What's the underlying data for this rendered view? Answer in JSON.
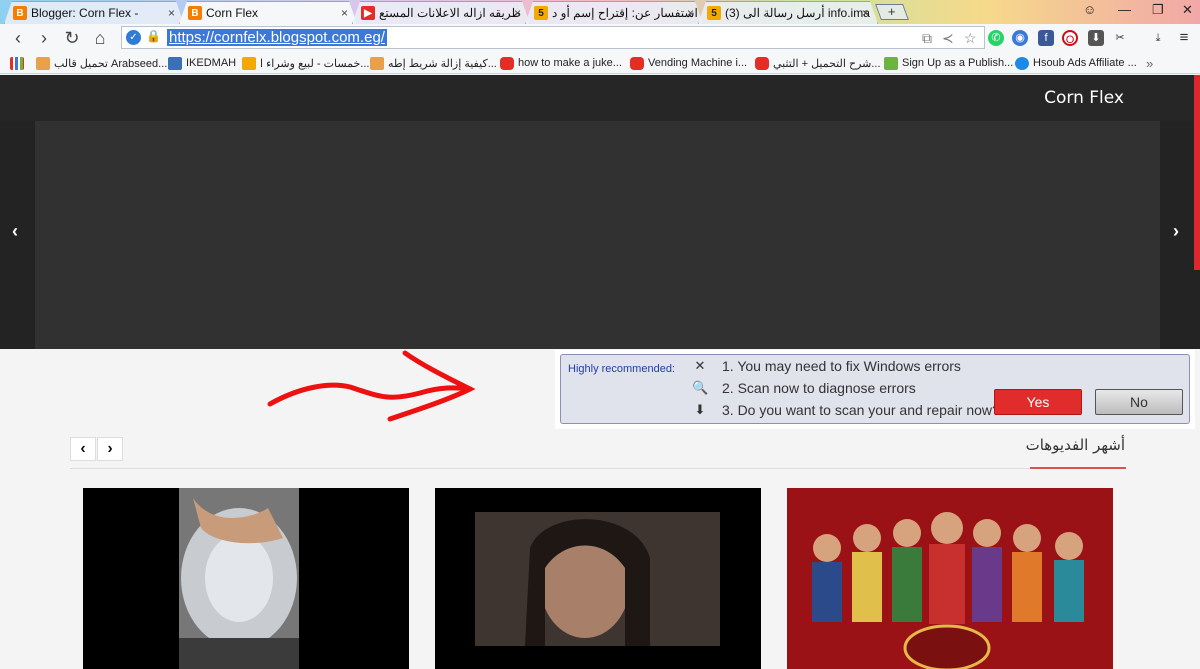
{
  "tabs": [
    {
      "title": "Blogger: Corn Flex -",
      "icon": "blogger-icon",
      "color": "#f57d00",
      "active": false
    },
    {
      "title": "Corn Flex",
      "icon": "blogger-icon",
      "color": "#f57d00",
      "active": true
    },
    {
      "title": "طريقه ازاله الاعلانات المستع",
      "icon": "youtube-icon",
      "color": "#e52d27",
      "active": false
    },
    {
      "title": "استفسار عن: إقتراح إسم أو د",
      "icon": "five-icon",
      "color": "#f2a900",
      "active": false
    },
    {
      "title": "(3) أرسل رسالة الى info.ima",
      "icon": "five-icon",
      "color": "#f2a900",
      "active": false
    }
  ],
  "tab_close_glyph": "×",
  "new_tab_glyph": "+",
  "window": {
    "minimize": "—",
    "restore": "❐",
    "close": "✕",
    "user": "☺"
  },
  "address": {
    "url": "https://cornfelx.blogspot.com.eg/"
  },
  "bookmarks": [
    {
      "label": "تحميل قالب Arabseed...",
      "color": "#e8a04a"
    },
    {
      "label": "IKEDMAH",
      "color": "#3b6fb6"
    },
    {
      "label": "خمسات - لبيع وشراء ا...",
      "color": "#f2a900"
    },
    {
      "label": "كيفية إزالة شريط إطه...",
      "color": "#e8a04a"
    },
    {
      "label": "how to make a juke...",
      "color": "#e52d27"
    },
    {
      "label": "Vending Machine i...",
      "color": "#e52d27"
    },
    {
      "label": "شرح التحميل + التثبي...",
      "color": "#e52d27"
    },
    {
      "label": "Sign Up as a Publish...",
      "color": "#6cb33f"
    },
    {
      "label": "Hsoub Ads Affiliate ...",
      "color": "#1e88e5"
    }
  ],
  "bookmarks_more": "»",
  "site": {
    "title": "Corn Flex",
    "slider_prev": "‹",
    "slider_next": "›"
  },
  "popup": {
    "heading": "Highly recommended:",
    "lines": [
      {
        "icon": "tools-icon",
        "glyph": "✕",
        "text": "1. You may need to fix Windows errors"
      },
      {
        "icon": "magnifier-icon",
        "glyph": "🔍",
        "text": "2. Scan now to diagnose errors"
      },
      {
        "icon": "download-circle-icon",
        "glyph": "⬇",
        "text": "3. Do you want to scan your and repair now?"
      }
    ],
    "yes_label": "Yes",
    "no_label": "No"
  },
  "videos": {
    "section_title": "أشهر الفديوهات",
    "prev": "‹",
    "next": "›"
  },
  "colors": {
    "accent_red": "#d9534f",
    "header_bg": "#262626",
    "popup_yes": "#e12c2c"
  }
}
